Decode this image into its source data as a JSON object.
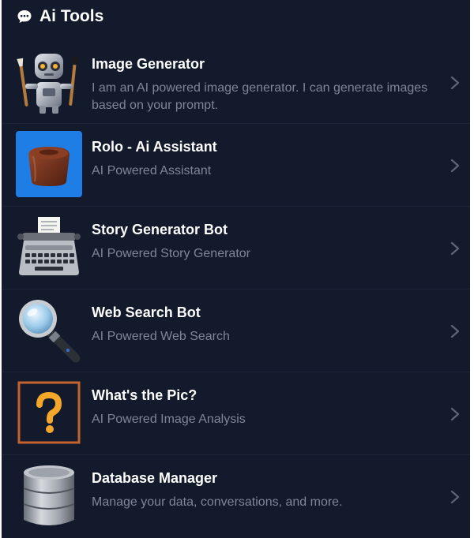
{
  "header": {
    "title": "Ai Tools",
    "icon": "chat-bubble-icon"
  },
  "items": [
    {
      "id": "image-generator",
      "title": "Image Generator",
      "description": "I am an AI powered image generator. I can generate images based on your prompt.",
      "icon": "robot-painter-icon"
    },
    {
      "id": "rolo-assistant",
      "title": "Rolo - Ai Assistant",
      "description": "AI Powered Assistant",
      "icon": "chocolate-icon"
    },
    {
      "id": "story-generator",
      "title": "Story Generator Bot",
      "description": "AI Powered Story Generator",
      "icon": "typewriter-icon"
    },
    {
      "id": "web-search",
      "title": "Web Search Bot",
      "description": "AI Powered Web Search",
      "icon": "magnifying-glass-icon"
    },
    {
      "id": "whats-the-pic",
      "title": "What's the Pic?",
      "description": "AI Powered Image Analysis",
      "icon": "question-mark-icon"
    },
    {
      "id": "database-manager",
      "title": "Database Manager",
      "description": "Manage your data, conversations, and more.",
      "icon": "database-stack-icon"
    }
  ],
  "colors": {
    "background": "#121a2b",
    "title": "#ffffff",
    "description": "#7d8798",
    "divider": "#1d2638",
    "chevron": "#5c6677"
  }
}
